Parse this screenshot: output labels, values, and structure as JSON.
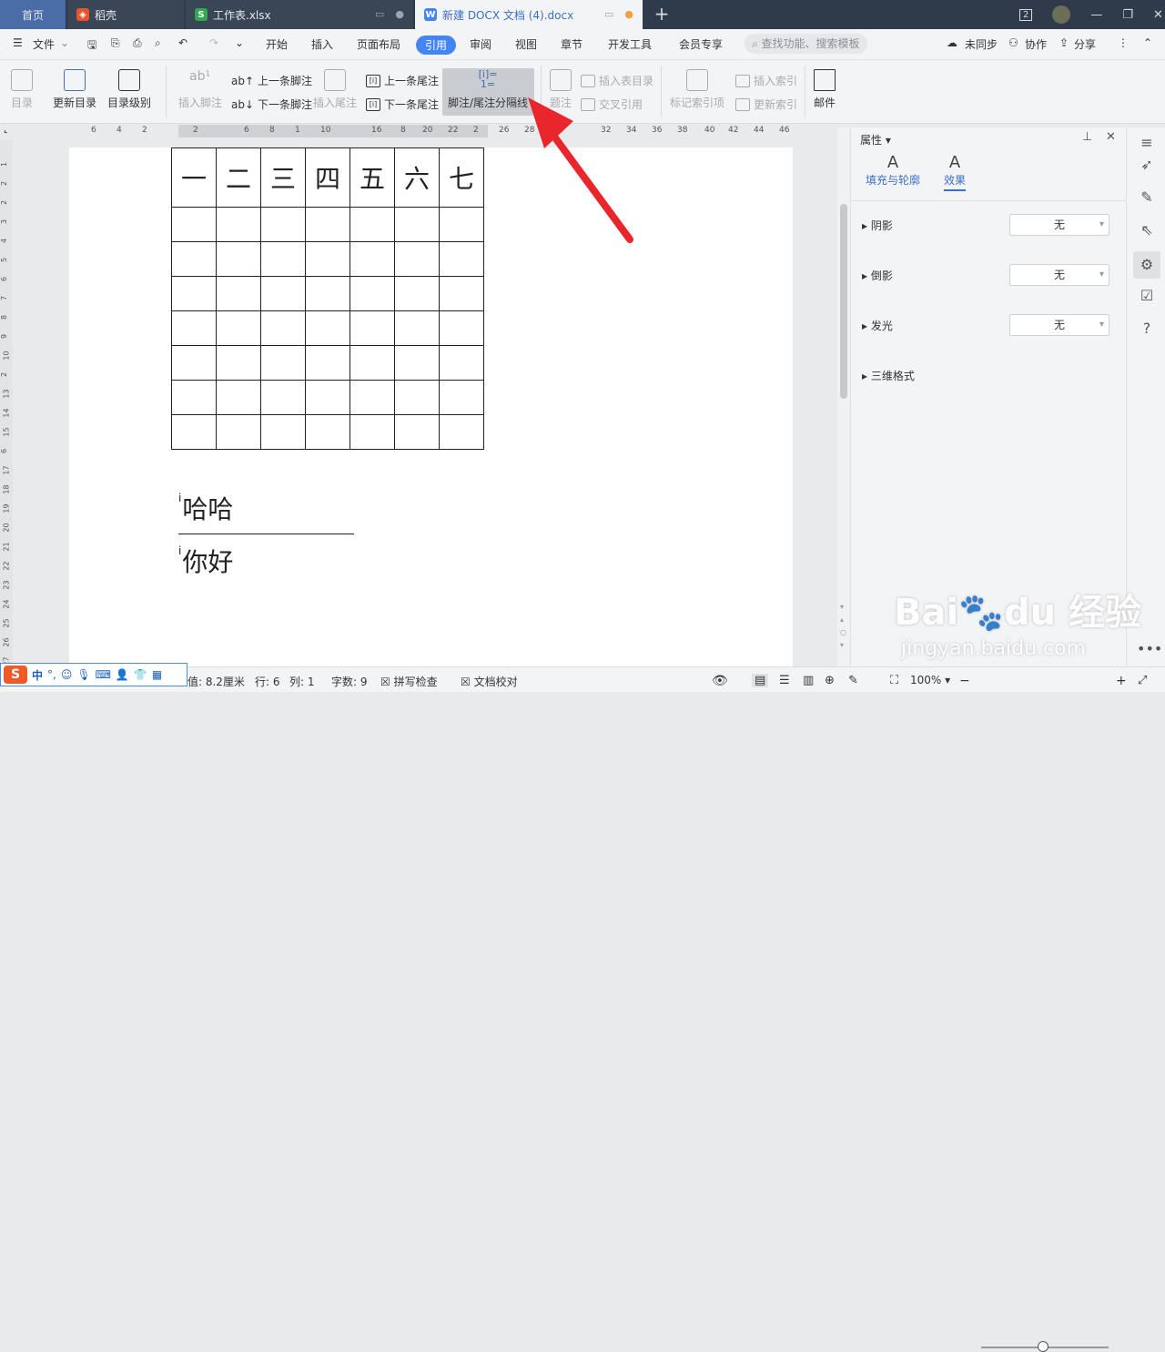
{
  "tabs": {
    "home": "首页",
    "daoke": "稻壳",
    "xlsx": "工作表.xlsx",
    "docx": "新建 DOCX 文档 (4).docx",
    "window_badge": "2"
  },
  "menu": {
    "file": "文件",
    "items": [
      "开始",
      "插入",
      "页面布局",
      "引用",
      "审阅",
      "视图",
      "章节",
      "开发工具",
      "会员专享"
    ],
    "active": "引用",
    "search_placeholder": "查找功能、搜索模板",
    "sync": "未同步",
    "collab": "协作",
    "share": "分享"
  },
  "ribbon": {
    "toc": "目录",
    "update_toc": "更新目录",
    "toc_level": "目录级别",
    "insert_footnote": "插入脚注",
    "prev_footnote": "上一条脚注",
    "next_footnote": "下一条脚注",
    "insert_endnote": "插入尾注",
    "prev_endnote": "上一条尾注",
    "next_endnote": "下一条尾注",
    "separator": "脚注/尾注分隔线",
    "caption": "题注",
    "insert_tof": "插入表目录",
    "cross_ref": "交叉引用",
    "mark_index": "标记索引项",
    "insert_index": "插入索引",
    "update_index": "更新索引",
    "mail": "邮件"
  },
  "ruler": {
    "h": [
      "6",
      "4",
      "2",
      "2",
      "6",
      "8",
      "1",
      "10",
      "16",
      "8",
      "20",
      "22",
      "2",
      "26",
      "28",
      "30",
      "32",
      "34",
      "36",
      "38",
      "40",
      "42",
      "44",
      "46"
    ],
    "v": [
      "1",
      "2",
      "2",
      "3",
      "4",
      "5",
      "6",
      "7",
      "8",
      "9",
      "10",
      "2",
      "13",
      "14",
      "15",
      "6",
      "17",
      "18",
      "19",
      "20",
      "21",
      "22",
      "23",
      "24",
      "25",
      "26",
      "27"
    ]
  },
  "document": {
    "table_header": [
      "一",
      "二",
      "三",
      "四",
      "五",
      "六",
      "七"
    ],
    "footnote_ref_mark": "i",
    "body_text": "哈哈",
    "footnote_mark": "i",
    "footnote_text": "你好"
  },
  "panel": {
    "title": "属性",
    "tab_fill": "填充与轮廓",
    "tab_effect": "效果",
    "shadow": "阴影",
    "reflection": "倒影",
    "glow": "发光",
    "three_d": "三维格式",
    "none": "无"
  },
  "status": {
    "setting": "值: 8.2厘米",
    "row": "行: 6",
    "col": "列: 1",
    "words": "字数: 9",
    "spell": "拼写检查",
    "proof": "文档校对",
    "zoom": "100%"
  },
  "ime": {
    "logo": "S",
    "lang": "中"
  },
  "watermark": {
    "brand": "Bai du 经验",
    "url": "jingyan.baidu.com"
  },
  "colors": {
    "accent": "#4385f5",
    "tabbar": "#2f3a4a",
    "arrow": "#e8262b"
  }
}
